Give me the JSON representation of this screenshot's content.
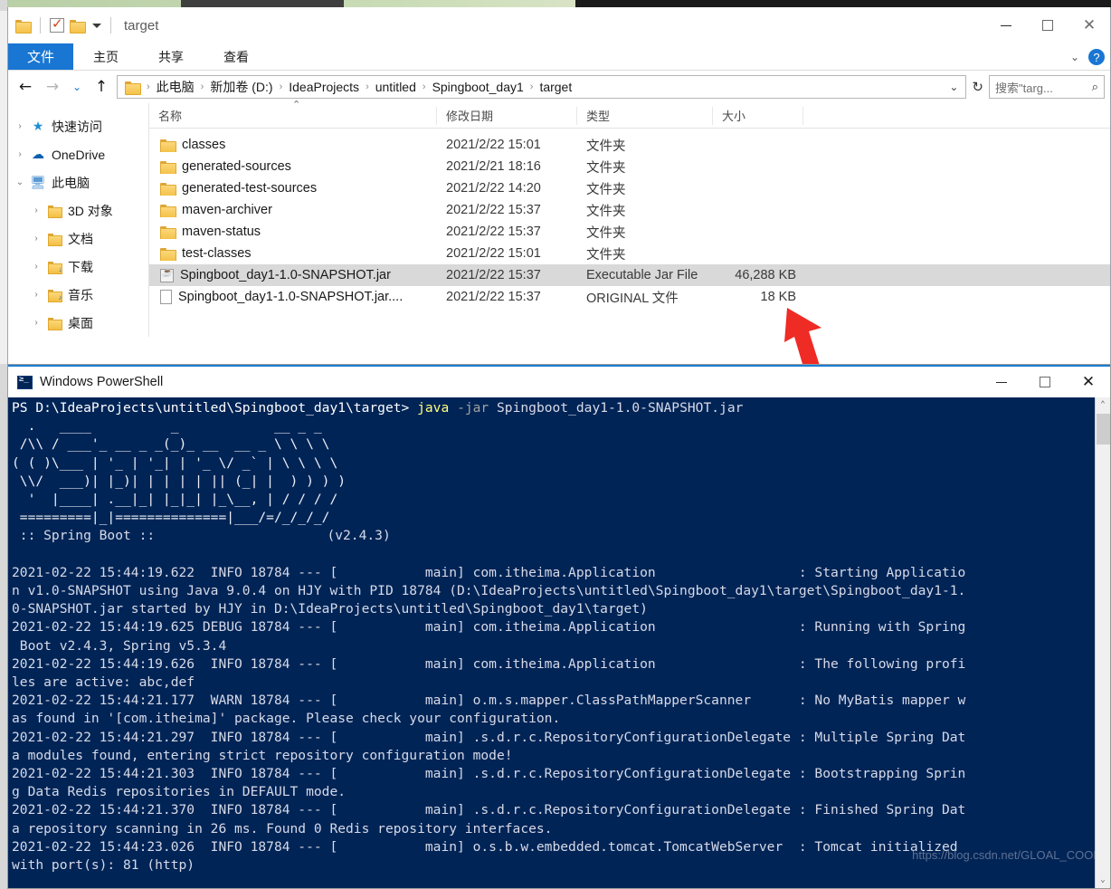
{
  "explorer": {
    "title": "target",
    "quick_access_icons": [
      "folder-icon",
      "checkbox-icon",
      "folder-icon",
      "chevron-down-icon"
    ],
    "window_controls": {
      "minimize": "—",
      "maximize": "▢",
      "close": "✕"
    },
    "ribbon_tabs": [
      {
        "label": "文件",
        "active": true
      },
      {
        "label": "主页",
        "active": false
      },
      {
        "label": "共享",
        "active": false
      },
      {
        "label": "查看",
        "active": false
      }
    ],
    "ribbon_right": {
      "chevron": "⌄",
      "help": "?"
    },
    "nav": {
      "back": "←",
      "forward": "→",
      "recent": "⌄",
      "up": "↑",
      "breadcrumbs": [
        "此电脑",
        "新加卷 (D:)",
        "IdeaProjects",
        "untitled",
        "Spingboot_day1",
        "target"
      ],
      "address_chevron": "⌄",
      "refresh": "↻"
    },
    "search": {
      "placeholder": "搜索\"targ...",
      "icon": "search-icon"
    },
    "sidebar": {
      "items": [
        {
          "label": "快速访问",
          "icon": "star-icon",
          "expander": "›",
          "indent": false
        },
        {
          "label": "OneDrive",
          "icon": "cloud-icon",
          "expander": "›",
          "indent": false
        },
        {
          "label": "此电脑",
          "icon": "computer-icon",
          "expander": "⌄",
          "indent": false
        },
        {
          "label": "3D 对象",
          "icon": "folder-3d-icon",
          "expander": "›",
          "indent": true
        },
        {
          "label": "文档",
          "icon": "folder-documents-icon",
          "expander": "›",
          "indent": true
        },
        {
          "label": "下载",
          "icon": "folder-downloads-icon",
          "expander": "›",
          "indent": true
        },
        {
          "label": "音乐",
          "icon": "folder-music-icon",
          "expander": "›",
          "indent": true
        },
        {
          "label": "桌面",
          "icon": "folder-desktop-icon",
          "expander": "›",
          "indent": true
        }
      ]
    },
    "columns": [
      "名称",
      "修改日期",
      "类型",
      "大小"
    ],
    "sort_indicator": "⌃",
    "files": [
      {
        "name": "classes",
        "date": "2021/2/22 15:01",
        "type": "文件夹",
        "size": "",
        "icon": "folder-icon",
        "selected": false
      },
      {
        "name": "generated-sources",
        "date": "2021/2/21 18:16",
        "type": "文件夹",
        "size": "",
        "icon": "folder-icon",
        "selected": false
      },
      {
        "name": "generated-test-sources",
        "date": "2021/2/22 14:20",
        "type": "文件夹",
        "size": "",
        "icon": "folder-icon",
        "selected": false
      },
      {
        "name": "maven-archiver",
        "date": "2021/2/22 15:37",
        "type": "文件夹",
        "size": "",
        "icon": "folder-icon",
        "selected": false
      },
      {
        "name": "maven-status",
        "date": "2021/2/22 15:37",
        "type": "文件夹",
        "size": "",
        "icon": "folder-icon",
        "selected": false
      },
      {
        "name": "test-classes",
        "date": "2021/2/22 15:01",
        "type": "文件夹",
        "size": "",
        "icon": "folder-icon",
        "selected": false
      },
      {
        "name": "Spingboot_day1-1.0-SNAPSHOT.jar",
        "date": "2021/2/22 15:37",
        "type": "Executable Jar File",
        "size": "46,288 KB",
        "icon": "jar-file-icon",
        "selected": true
      },
      {
        "name": "Spingboot_day1-1.0-SNAPSHOT.jar....",
        "date": "2021/2/22 15:37",
        "type": "ORIGINAL 文件",
        "size": "18 KB",
        "icon": "generic-file-icon",
        "selected": false
      }
    ]
  },
  "annotation": {
    "arrow_color": "#ef2b25",
    "points_to": "46,288 KB"
  },
  "powershell": {
    "title": "Windows PowerShell",
    "icon": "powershell-icon",
    "window_controls": {
      "minimize": "—",
      "maximize": "▢",
      "close": "✕"
    },
    "prompt": "PS D:\\IdeaProjects\\untitled\\Spingboot_day1\\target> ",
    "command_keyword": "java",
    "command_param": "-jar",
    "command_arg": "Spingboot_day1-1.0-SNAPSHOT.jar",
    "banner": [
      "  .   ____          _            __ _ _",
      " /\\\\ / ___'_ __ _ _(_)_ __  __ _ \\ \\ \\ \\",
      "( ( )\\___ | '_ | '_| | '_ \\/ _` | \\ \\ \\ \\",
      " \\\\/  ___)| |_)| | | | | || (_| |  ) ) ) )",
      "  '  |____| .__|_| |_|_| |_\\__, | / / / /",
      " =========|_|==============|___/=/_/_/_/"
    ],
    "banner_footer_left": " :: Spring Boot :: ",
    "banner_footer_right": "       (v2.4.3)",
    "log_lines": [
      "2021-02-22 15:44:19.622  INFO 18784 --- [           main] com.itheima.Application                  : Starting Applicatio",
      "n v1.0-SNAPSHOT using Java 9.0.4 on HJY with PID 18784 (D:\\IdeaProjects\\untitled\\Spingboot_day1\\target\\Spingboot_day1-1.",
      "0-SNAPSHOT.jar started by HJY in D:\\IdeaProjects\\untitled\\Spingboot_day1\\target)",
      "2021-02-22 15:44:19.625 DEBUG 18784 --- [           main] com.itheima.Application                  : Running with Spring",
      " Boot v2.4.3, Spring v5.3.4",
      "2021-02-22 15:44:19.626  INFO 18784 --- [           main] com.itheima.Application                  : The following profi",
      "les are active: abc,def",
      "2021-02-22 15:44:21.177  WARN 18784 --- [           main] o.m.s.mapper.ClassPathMapperScanner      : No MyBatis mapper w",
      "as found in '[com.itheima]' package. Please check your configuration.",
      "2021-02-22 15:44:21.297  INFO 18784 --- [           main] .s.d.r.c.RepositoryConfigurationDelegate : Multiple Spring Dat",
      "a modules found, entering strict repository configuration mode!",
      "2021-02-22 15:44:21.303  INFO 18784 --- [           main] .s.d.r.c.RepositoryConfigurationDelegate : Bootstrapping Sprin",
      "g Data Redis repositories in DEFAULT mode.",
      "2021-02-22 15:44:21.370  INFO 18784 --- [           main] .s.d.r.c.RepositoryConfigurationDelegate : Finished Spring Dat",
      "a repository scanning in 26 ms. Found 0 Redis repository interfaces.",
      "2021-02-22 15:44:23.026  INFO 18784 --- [           main] o.s.b.w.embedded.tomcat.TomcatWebServer  : Tomcat initialized",
      "with port(s): 81 (http)"
    ],
    "scrollbar": {
      "up": "⌃",
      "down": "⌄"
    },
    "watermark": "https://blog.csdn.net/GLOAL_COOK"
  }
}
